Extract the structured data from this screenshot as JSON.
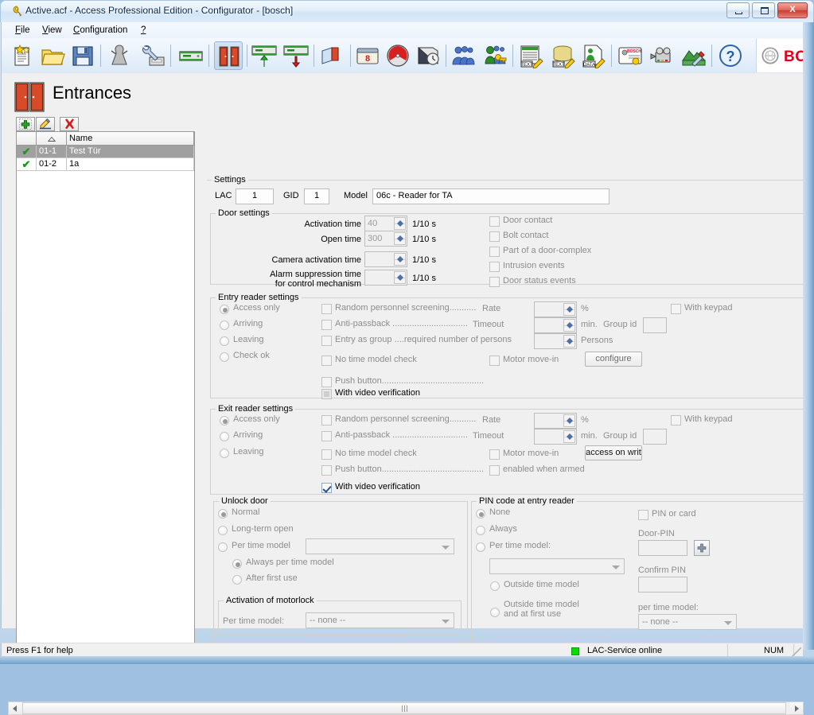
{
  "window": {
    "title": "Active.acf - Access Professional Edition - Configurator - [bosch]",
    "title_icon": "wrench-icon",
    "minimize_label": "–",
    "maximize_label": "❐",
    "close_label": "X"
  },
  "menu": [
    {
      "label": "File",
      "accel": "F"
    },
    {
      "label": "View",
      "accel": "V"
    },
    {
      "label": "Configuration",
      "accel": "C"
    },
    {
      "label": "?",
      "accel": ""
    }
  ],
  "toolbar": {
    "buttons": [
      {
        "name": "new-document-icon",
        "tip": "New"
      },
      {
        "name": "open-folder-icon",
        "tip": "Open"
      },
      {
        "name": "save-disk-icon",
        "tip": "Save"
      },
      {
        "name": "personnel-icon",
        "tip": "Personnel data"
      },
      {
        "name": "device-config-icon",
        "tip": "Device configuration"
      },
      {
        "name": "controller-icon",
        "tip": "Controller"
      },
      {
        "name": "entrances-icon",
        "tip": "Entrances",
        "pressed": true
      },
      {
        "name": "entry-reader-icon",
        "tip": "Entry reader"
      },
      {
        "name": "exit-reader-icon",
        "tip": "Exit reader"
      },
      {
        "name": "area-icon",
        "tip": "Areas"
      },
      {
        "name": "calendar-icon",
        "tip": "Calendar"
      },
      {
        "name": "clock-icon",
        "tip": "Time models"
      },
      {
        "name": "day-model-icon",
        "tip": "Day models"
      },
      {
        "name": "persons-group-icon",
        "tip": "Person groups"
      },
      {
        "name": "authorization-key-icon",
        "tip": "Authorizations"
      },
      {
        "name": "text-report-icon",
        "tip": "Text report"
      },
      {
        "name": "data-stack-icon",
        "tip": "Database"
      },
      {
        "name": "data-report-icon",
        "tip": "Data report"
      },
      {
        "name": "card-design-icon",
        "tip": "Card design"
      },
      {
        "name": "video-camera-icon",
        "tip": "Video"
      },
      {
        "name": "map-tools-icon",
        "tip": "Map tools"
      },
      {
        "name": "help-icon",
        "tip": "Help"
      }
    ],
    "brand": "BO"
  },
  "page": {
    "icon": "double-door-icon",
    "title": "Entrances"
  },
  "list": {
    "toolbar": {
      "add": "+",
      "edit": "✎",
      "delete": "✕"
    },
    "columns": [
      "",
      "",
      "Name"
    ],
    "sort_indicator": "ascending",
    "rows": [
      {
        "checked": "✔",
        "id": "01-1",
        "name": "Test Tür",
        "selected": true
      },
      {
        "checked": "✔",
        "id": "01-2",
        "name": "1a",
        "selected": false
      }
    ]
  },
  "settings": {
    "legend": "Settings",
    "lac_label": "LAC",
    "lac_value": "1",
    "gid_label": "GID",
    "gid_value": "1",
    "model_label": "Model",
    "model_value": "06c - Reader for TA"
  },
  "door_settings": {
    "legend": "Door settings",
    "rows": [
      {
        "label": "Activation time",
        "value": "40",
        "unit": "1/10 s"
      },
      {
        "label": "Open time",
        "value": "300",
        "unit": "1/10 s"
      },
      {
        "label": "Camera activation time",
        "value": "",
        "unit": "1/10 s"
      },
      {
        "label": "Alarm suppression time",
        "label2": "for control mechanism",
        "value": "",
        "unit": "1/10 s"
      }
    ],
    "checkboxes": [
      {
        "label": "Door contact",
        "checked": false
      },
      {
        "label": "Bolt contact",
        "checked": false
      },
      {
        "label": "Part of a door-complex",
        "checked": false
      },
      {
        "label": "Intrusion events",
        "checked": false
      },
      {
        "label": "Door status events",
        "checked": false
      }
    ]
  },
  "entry_reader": {
    "legend": "Entry reader settings",
    "modes": [
      {
        "label": "Access only",
        "selected": true
      },
      {
        "label": "Arriving",
        "selected": false
      },
      {
        "label": "Leaving",
        "selected": false
      },
      {
        "label": "Check ok",
        "selected": false
      }
    ],
    "random_screening": {
      "label": "Random personnel screening...........",
      "checked": false,
      "field_label": "Rate",
      "value": "",
      "unit": "%"
    },
    "anti_passback": {
      "label": "Anti-passback ...............................",
      "checked": false,
      "field_label": "Timeout",
      "value": "",
      "unit": "min."
    },
    "group_id_label": "Group id",
    "group_id_value": "",
    "entry_as_group": {
      "label": "Entry as group ....required number of persons",
      "checked": false,
      "value": "",
      "unit": "Persons"
    },
    "no_time_model": {
      "label": "No time model check",
      "checked": false
    },
    "push_button": {
      "label": "Push button..........................................",
      "checked": false
    },
    "video_verification": {
      "label": "With video verification",
      "checked": true,
      "disabled": true
    },
    "motor_move_in": {
      "label": "Motor move-in",
      "checked": false
    },
    "configure_button": "configure",
    "with_keypad": {
      "label": "With keypad",
      "checked": false
    }
  },
  "exit_reader": {
    "legend": "Exit reader settings",
    "modes": [
      {
        "label": "Access only",
        "selected": true
      },
      {
        "label": "Arriving",
        "selected": false
      },
      {
        "label": "Leaving",
        "selected": false
      }
    ],
    "random_screening": {
      "label": "Random personnel screening...........",
      "checked": false,
      "field_label": "Rate",
      "value": "",
      "unit": "%"
    },
    "anti_passback": {
      "label": "Anti-passback ...............................",
      "checked": false,
      "field_label": "Timeout",
      "value": "",
      "unit": "min."
    },
    "group_id_label": "Group id",
    "group_id_value": "",
    "no_time_model": {
      "label": "No time model check",
      "checked": false
    },
    "push_button": {
      "label": "Push button..........................................",
      "checked": false
    },
    "video_verification": {
      "label": "With video verification",
      "checked": true
    },
    "motor_move_in": {
      "label": "Motor move-in",
      "checked": false
    },
    "enabled_when_armed": {
      "label": "enabled when armed",
      "checked": false
    },
    "access_button": "access on writ",
    "with_keypad": {
      "label": "With keypad",
      "checked": false
    }
  },
  "unlock_door": {
    "legend": "Unlock door",
    "options": [
      {
        "label": "Normal",
        "selected": true
      },
      {
        "label": "Long-term open",
        "selected": false
      },
      {
        "label": "Per time model",
        "selected": false
      }
    ],
    "time_model_value": "",
    "sub_options": [
      {
        "label": "Always per time model",
        "selected": true
      },
      {
        "label": "After first use",
        "selected": false
      }
    ],
    "motorlock": {
      "legend": "Activation of motorlock",
      "label": "Per time model:",
      "value": "-- none --"
    }
  },
  "pin_code": {
    "legend": "PIN code at entry reader",
    "options": [
      {
        "label": "None",
        "selected": true
      },
      {
        "label": "Always",
        "selected": false
      },
      {
        "label": "Per time model:",
        "selected": false
      }
    ],
    "time_model_value": "",
    "sub_options": [
      {
        "label": "Outside time model",
        "selected": false
      },
      {
        "label": "Outside time model and at first use",
        "selected": false,
        "line1": "Outside time model",
        "line2": "and at first use"
      }
    ],
    "pin_or_card": {
      "label": "PIN or card",
      "checked": false
    },
    "door_pin_label": "Door-PIN",
    "door_pin_value": "",
    "add_pin_button": "+",
    "confirm_pin_label": "Confirm PIN",
    "confirm_pin_value": "",
    "per_time_model_label": "per time model:",
    "per_time_model_value": "-- none --"
  },
  "statusbar": {
    "help": "Press F1 for help",
    "service_status": "LAC-Service online",
    "service_led_color": "#00e000",
    "num_lock": "NUM"
  },
  "scrollbar": {
    "left_arrow": "◂",
    "right_arrow": "▸"
  }
}
